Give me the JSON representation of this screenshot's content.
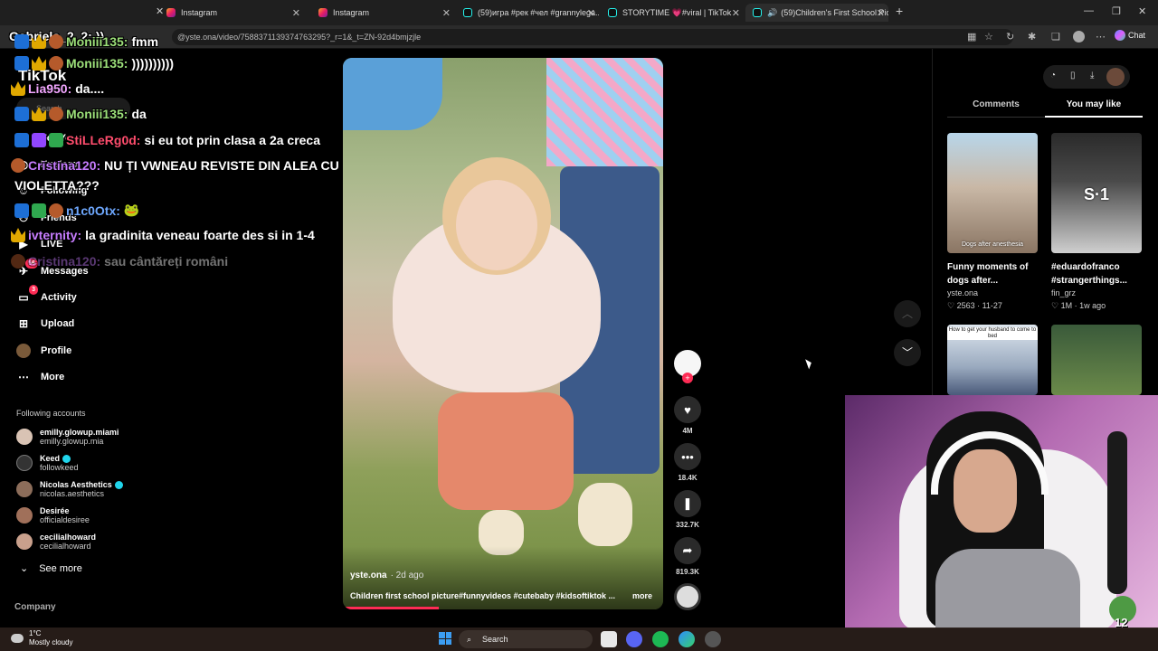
{
  "browser": {
    "tabs": [
      {
        "title": "",
        "close": "✕"
      },
      {
        "title": "Instagram",
        "close": "✕"
      },
      {
        "title": "Instagram",
        "close": "✕"
      },
      {
        "title": "(59)игра #рек #чел #grannylega...",
        "close": "✕"
      },
      {
        "title": "STORYTIME 💗#viral | TikTok",
        "close": "✕"
      },
      {
        "title": "(59)Children's First School Pic",
        "close": "✕"
      }
    ],
    "new_tab": "+",
    "url": "@yste.ona/video/7588371139374763295?_r=1&_t=ZN-92d4bmjzjle",
    "chat_label": "Chat",
    "window_controls": [
      "—",
      "❐",
      "✕"
    ]
  },
  "tiktok": {
    "logo": "TikTok",
    "search_placeholder": "Search",
    "nav": [
      {
        "label": "For You",
        "icon": "home-icon"
      },
      {
        "label": "Explore",
        "icon": "compass-icon"
      },
      {
        "label": "Following",
        "icon": "following-icon"
      },
      {
        "label": "Friends",
        "icon": "friends-icon"
      },
      {
        "label": "LIVE",
        "icon": "live-icon"
      },
      {
        "label": "Messages",
        "icon": "messages-icon",
        "badge": "56"
      },
      {
        "label": "Activity",
        "icon": "activity-icon",
        "badge": "3"
      },
      {
        "label": "Upload",
        "icon": "upload-icon"
      },
      {
        "label": "Profile",
        "icon": "profile-icon"
      },
      {
        "label": "More",
        "icon": "more-icon"
      }
    ],
    "following_title": "Following accounts",
    "following": [
      {
        "name": "emilly.glowup.miami",
        "handle": "emilly.glowup.mia",
        "verified": false,
        "color": "#d9c3b4"
      },
      {
        "name": "Keed",
        "handle": "followkeed",
        "verified": true,
        "color": "#333333"
      },
      {
        "name": "Nicolas Aesthetics",
        "handle": "nicolas.aesthetics",
        "verified": true,
        "color": "#8c6d5a"
      },
      {
        "name": "Desirée",
        "handle": "officialdesiree",
        "verified": false,
        "color": "#a0705a"
      },
      {
        "name": "cecilialhoward",
        "handle": "cecilialhoward",
        "verified": false,
        "color": "#c9a08c"
      }
    ],
    "see_more": "See more",
    "company": "Company"
  },
  "chat_overlay": [
    {
      "user": "Gabriela_2_2:",
      "msg": "))",
      "color": "#ffffff",
      "badges": []
    },
    {
      "user": "Moniii135:",
      "msg": "fmm",
      "color": "#9de07a",
      "badges": [
        "blue",
        "gold",
        "fox"
      ]
    },
    {
      "user": "Moniii135:",
      "msg": "))))))))))",
      "color": "#9de07a",
      "badges": [
        "blue",
        "gold",
        "fox"
      ]
    },
    {
      "user": "Lia950:",
      "msg": "da....",
      "color": "#f2a6ff",
      "badges": [
        "gold"
      ]
    },
    {
      "user": "Moniii135:",
      "msg": "da",
      "color": "#9de07a",
      "badges": [
        "blue",
        "gold",
        "fox"
      ]
    },
    {
      "user": "StiLLeRg0d:",
      "msg": "si eu tot prin clasa a 2a creca",
      "color": "#ff4d6d",
      "badges": [
        "blue",
        "sub",
        "green"
      ]
    },
    {
      "user": "Cristina120:",
      "msg": "NU ȚI VWNEAU REVISTE DIN ALEA CU",
      "color": "#c77dff",
      "badges": [
        "fox"
      ]
    },
    {
      "user": "",
      "msg": "VIOLETTA???",
      "color": "#ffffff",
      "badges": []
    },
    {
      "user": "n1c0Otx:",
      "msg": "🐸",
      "color": "#6ea8ff",
      "badges": [
        "blue",
        "green",
        "fox"
      ]
    },
    {
      "user": "ivternity:",
      "msg": "la gradinita veneau foarte des si in 1-4",
      "color": "#c77dff",
      "badges": [
        "gold"
      ]
    },
    {
      "user": "Cristina120:",
      "msg": "sau cântăreți români",
      "color": "#c77dff",
      "badges": [
        "fox"
      ]
    }
  ],
  "video": {
    "author": "yste.ona",
    "age": "· 2d ago",
    "caption": "Children first school picture#funnyvideos #cutebaby #kidsoftiktok ...",
    "more": "more",
    "progress": 0.3
  },
  "actions": {
    "likes": "4M",
    "comments": "18.4K",
    "saves": "332.7K",
    "shares": "819.3K"
  },
  "right_panel": {
    "tabs": [
      "Comments",
      "You may like"
    ],
    "active_tab": 1,
    "recs": [
      {
        "title": "Funny moments of dogs after...",
        "author": "yste.ona",
        "stat": "♡ 2563 · 11-27",
        "thumb_text": "Dogs after anesthesia",
        "colors": [
          "#b8d6ea",
          "#8a7563"
        ]
      },
      {
        "title": "#eduardofranco #strangerthings...",
        "author": "fin_grz",
        "stat": "♡ 1M · 1w ago",
        "thumb_text": "S·1",
        "colors": [
          "#2a2a2a",
          "#cfcfcf"
        ]
      },
      {
        "title": "",
        "author": "",
        "stat": "",
        "thumb_text": "How to get your husband to come to bed",
        "colors": [
          "#dfe7ef",
          "#4a5a7a"
        ]
      },
      {
        "title": "",
        "author": "",
        "stat": "",
        "thumb_text": "",
        "colors": [
          "#3a5a3a",
          "#6b8a4a"
        ]
      }
    ]
  },
  "webcam": {
    "overlay_number": "12"
  },
  "taskbar": {
    "temp": "1°C",
    "weather": "Mostly cloudy",
    "search": "Search"
  }
}
